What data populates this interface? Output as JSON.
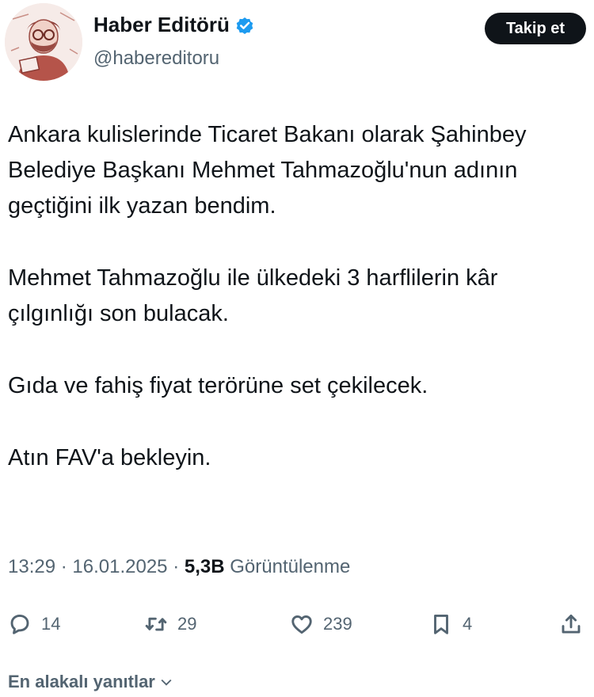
{
  "author": {
    "display_name": "Haber Editörü",
    "handle": "@habereditoru",
    "verified": true,
    "verified_color": "#1d9bf0"
  },
  "follow_button": {
    "label": "Takip et"
  },
  "tweet": {
    "paragraphs": [
      "Ankara kulislerinde Ticaret Bakanı olarak Şahinbey Belediye Başkanı Mehmet Tahmazoğlu'nun adının geçtiğini ilk yazan bendim.",
      "Mehmet Tahmazoğlu ile ülkedeki 3 harflilerin kâr çılgınlığı son bulacak.",
      "Gıda ve fahiş fiyat terörüne set çekilecek.",
      "Atın FAV'a bekleyin."
    ]
  },
  "meta": {
    "time": "13:29",
    "separator": "·",
    "date": "16.01.2025",
    "views_count": "5,3B",
    "views_label": "Görüntülenme"
  },
  "actions": {
    "reply": {
      "icon": "reply-icon",
      "count": "14"
    },
    "retweet": {
      "icon": "retweet-icon",
      "count": "29"
    },
    "like": {
      "icon": "heart-icon",
      "count": "239"
    },
    "bookmark": {
      "icon": "bookmark-icon",
      "count": "4"
    },
    "share": {
      "icon": "share-icon"
    }
  },
  "replies": {
    "sort_label": "En alakalı yanıtlar"
  },
  "colors": {
    "primary_text": "#0f1419",
    "secondary_text": "#536471",
    "button_bg": "#0f1419",
    "avatar_tint": "#b5544a"
  }
}
